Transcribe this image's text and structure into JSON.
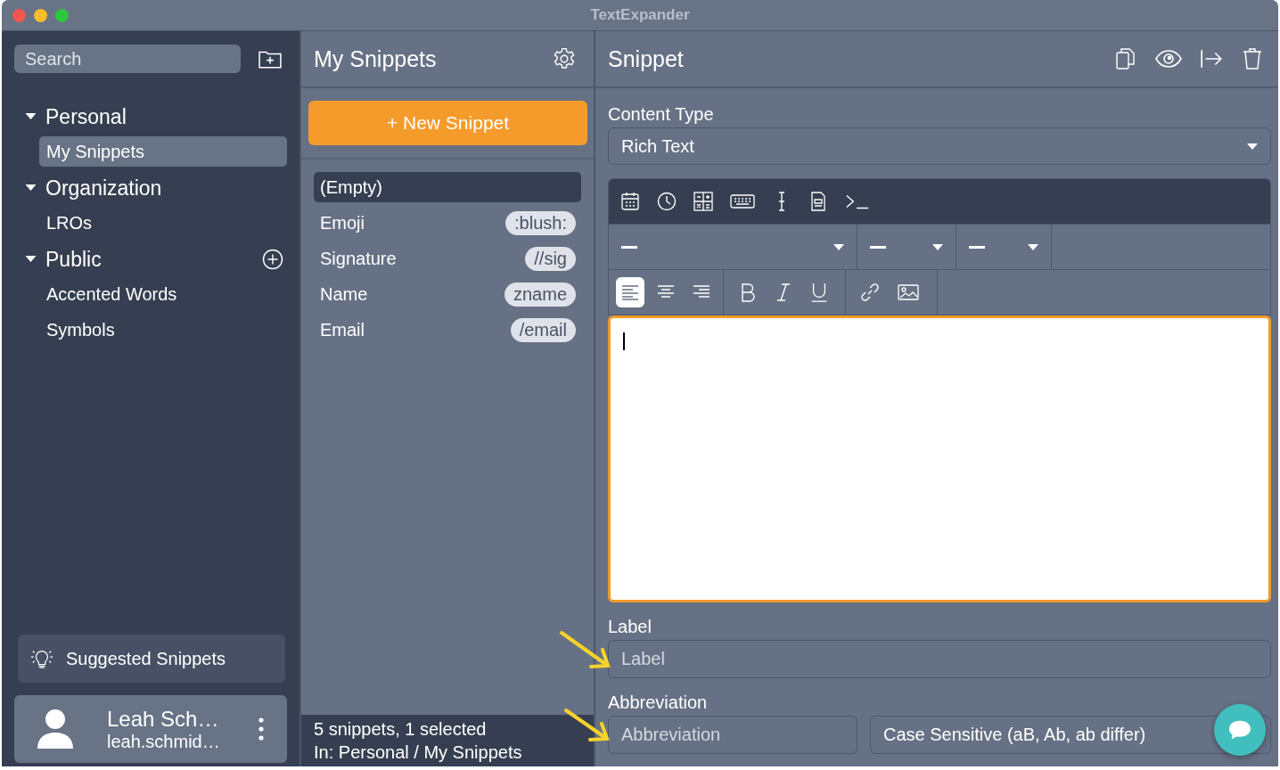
{
  "window": {
    "title": "TextExpander"
  },
  "sidebar": {
    "search": {
      "placeholder": "Search"
    },
    "groups": [
      {
        "label": "Personal",
        "expanded": true,
        "add_button": false,
        "children": [
          {
            "label": "My Snippets",
            "selected": true
          }
        ]
      },
      {
        "label": "Organization",
        "expanded": true,
        "add_button": false,
        "children": [
          {
            "label": "LROs",
            "selected": false
          }
        ]
      },
      {
        "label": "Public",
        "expanded": true,
        "add_button": true,
        "children": [
          {
            "label": "Accented Words",
            "selected": false
          },
          {
            "label": "Symbols",
            "selected": false
          }
        ]
      }
    ],
    "suggested": {
      "label": "Suggested Snippets"
    },
    "user": {
      "name": "Leah Sch…",
      "email": "leah.schmid…"
    }
  },
  "snippet_list": {
    "title": "My Snippets",
    "new_button": "+ New Snippet",
    "snippets": [
      {
        "label": "(Empty)",
        "selected": true
      },
      {
        "label": "Emoji",
        "abbreviation": ":blush:",
        "selected": false
      },
      {
        "label": "Signature",
        "abbreviation": "//sig",
        "selected": false
      },
      {
        "label": "Name",
        "abbreviation": "zname",
        "selected": false
      },
      {
        "label": "Email",
        "abbreviation": "/email",
        "selected": false
      }
    ],
    "status": [
      "5 snippets, 1 selected",
      "In: Personal / My Snippets"
    ]
  },
  "editor": {
    "title": "Snippet",
    "content_type": {
      "label": "Content Type",
      "value": "Rich Text"
    },
    "alignment": [
      {
        "kind": "left",
        "selected": true
      },
      {
        "kind": "center",
        "selected": false
      },
      {
        "kind": "right",
        "selected": false
      }
    ],
    "label": {
      "label": "Label",
      "placeholder": "Label"
    },
    "abbreviation": {
      "label": "Abbreviation",
      "placeholder": "Abbreviation",
      "case_option": "Case Sensitive (aB, Ab, ab differ)"
    }
  }
}
